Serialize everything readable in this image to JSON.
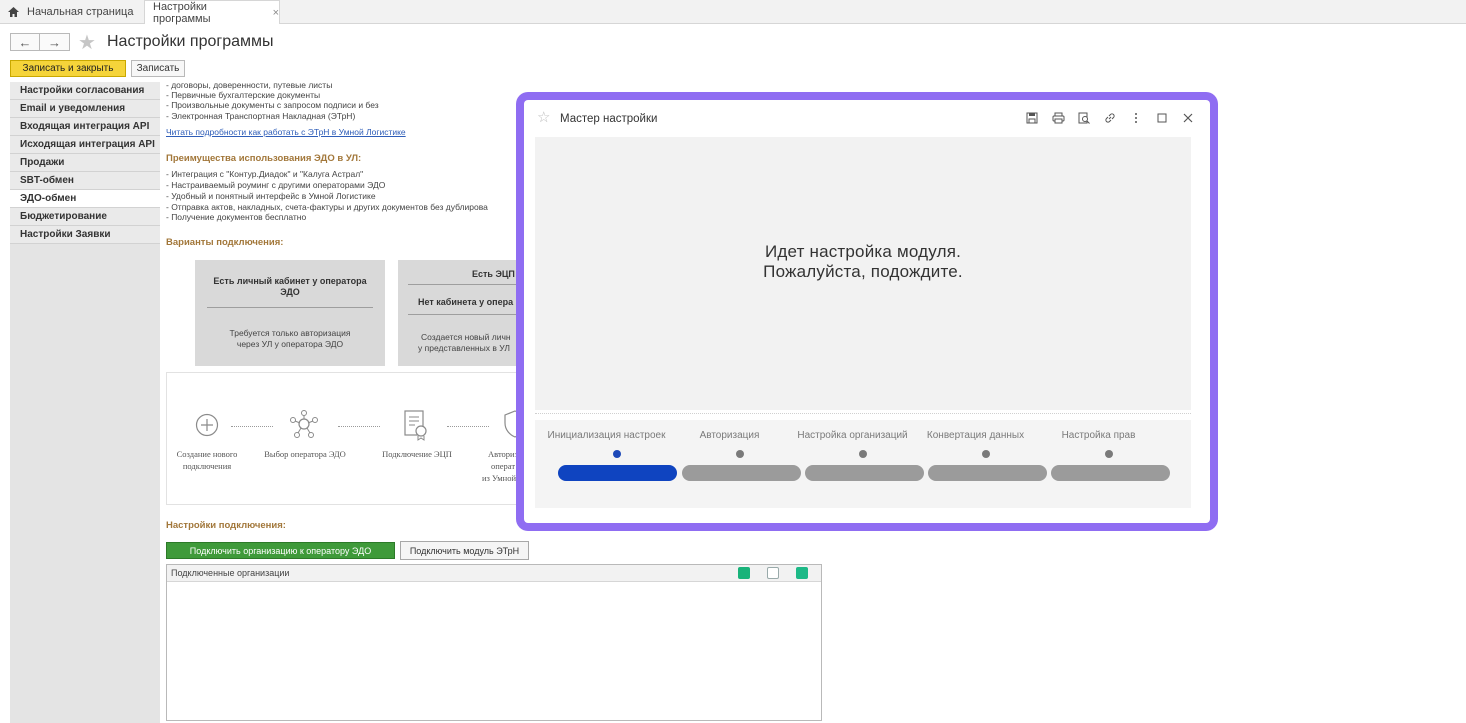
{
  "topbar": {
    "home_tab": "Начальная страница",
    "active_tab": "Настройки программы",
    "close_glyph": "×"
  },
  "header": {
    "title": "Настройки программы",
    "back_glyph": "←",
    "forward_glyph": "→",
    "star_glyph": "★"
  },
  "actions": {
    "save_close_label": "Записать и закрыть",
    "save_label": "Записать"
  },
  "sidebar": {
    "items": [
      {
        "label": "Настройки согласования"
      },
      {
        "label": "Email и уведомления"
      },
      {
        "label": "Входящая интеграция API"
      },
      {
        "label": "Исходящая интеграция API"
      },
      {
        "label": "Продажи"
      },
      {
        "label": "SBT-обмен"
      },
      {
        "label": "ЭДО-обмен"
      },
      {
        "label": "Бюджетирование"
      },
      {
        "label": "Настройки Заявки"
      }
    ]
  },
  "content": {
    "doc_lines": [
      "- договоры, доверенности, путевые листы",
      "- Первичные бухгалтерские документы",
      "- Произвольные документы с запросом подписи и без",
      "- Электронная Транспортная Накладная (ЭТрН)"
    ],
    "read_more_link": "Читать подробности как работать с ЭТрН в Умной Логистике",
    "advantages_heading": "Преимущества использования ЭДО в УЛ:",
    "advantages": [
      "- Интеграция с \"Контур.Диадок\" и \"Калуга Астрал\"",
      "- Настраиваемый роуминг с другими операторами ЭДО",
      "- Удобный и понятный интерфейс в Умной Логистике",
      "- Отправка актов, накладных, счета-фактуры и других документов без дублирова",
      "- Получение документов бесплатно"
    ],
    "variants_heading": "Варианты подключения:",
    "card1": {
      "title_line1": "Есть личный кабинет у оператора",
      "title_line2": "ЭДО",
      "desc_line1": "Требуется только авторизация",
      "desc_line2": "через УЛ у оператора ЭДО"
    },
    "card2": {
      "title_top": "Есть ЭЦП",
      "title_line1": "Нет кабинета у опера",
      "desc_line1": "Создается новый личн",
      "desc_line2": "у представленных в УЛ"
    },
    "steps": [
      {
        "line1": "Создание нового",
        "line2": "подключения"
      },
      {
        "line1": "Выбор оператора ЭДО",
        "line2": ""
      },
      {
        "line1": "Подключение ЭЦП",
        "line2": ""
      },
      {
        "line1": "Авториз",
        "line2": "операт",
        "line3": "из Умной"
      }
    ],
    "connection_heading": "Настройки подключения:",
    "connect_org_button": "Подключить организацию к оператору ЭДО",
    "connect_module_button": "Подключить модуль ЭТрН",
    "table_header": "Подключенные организации"
  },
  "modal": {
    "title": "Мастер настройки",
    "star_glyph": "☆",
    "message_line1": "Идет настройка модуля.",
    "message_line2": "Пожалуйста, подождите.",
    "steps": [
      {
        "label": "Инициализация настроек",
        "active": true
      },
      {
        "label": "Авторизация",
        "active": false
      },
      {
        "label": "Настройка организаций",
        "active": false
      },
      {
        "label": "Конвертация данных",
        "active": false
      },
      {
        "label": "Настройка прав",
        "active": false
      }
    ]
  },
  "colors": {
    "modal_frame": "#8f6df2",
    "active_step": "#0f44c0",
    "primary_button": "#f5d43a",
    "green_button": "#3f9a3a",
    "section_heading": "#a2773a"
  }
}
